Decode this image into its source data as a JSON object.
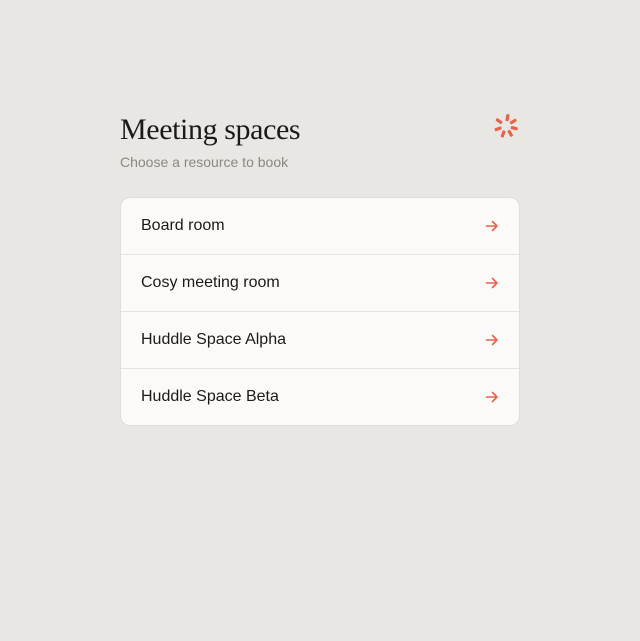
{
  "header": {
    "title": "Meeting spaces",
    "subtitle": "Choose a resource to book",
    "logo_icon": "brand-burst-icon"
  },
  "colors": {
    "accent": "#e8624a",
    "background": "#e9e7e3",
    "card": "#fbfaf8",
    "text": "#1b1a18",
    "muted": "#8b8883"
  },
  "resources": [
    {
      "label": "Board room",
      "icon": "arrow-right-icon"
    },
    {
      "label": "Cosy meeting room",
      "icon": "arrow-right-icon"
    },
    {
      "label": "Huddle Space Alpha",
      "icon": "arrow-right-icon"
    },
    {
      "label": "Huddle Space Beta",
      "icon": "arrow-right-icon"
    }
  ]
}
